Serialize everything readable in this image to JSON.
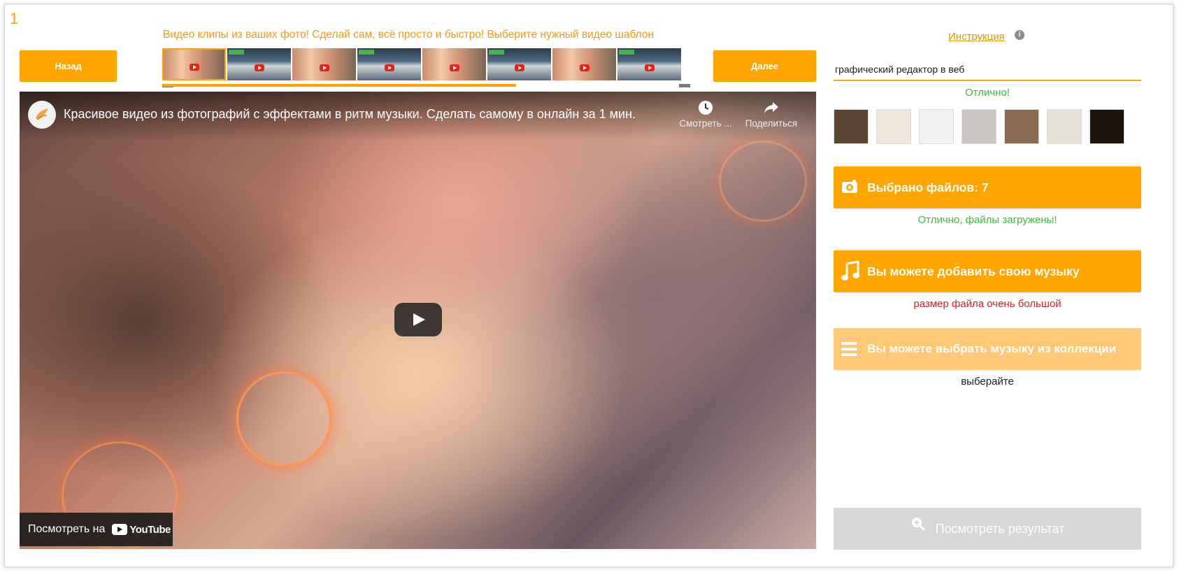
{
  "page": {
    "step_number": "1",
    "tagline": "Видео клипы из ваших фото! Сделай сам, всё просто и быстро! Выберите нужный видео шаблон"
  },
  "nav": {
    "back_label": "Назад",
    "next_label": "Далее"
  },
  "templates": [
    {
      "kind": "portrait",
      "selected": true
    },
    {
      "kind": "scene"
    },
    {
      "kind": "portrait"
    },
    {
      "kind": "scene"
    },
    {
      "kind": "portrait"
    },
    {
      "kind": "scene"
    },
    {
      "kind": "portrait"
    },
    {
      "kind": "scene"
    }
  ],
  "video": {
    "title": "Красивое видео из фотографий с эффектами в ритм музыки. Сделать самому в онлайн за 1 мин.",
    "watch_later_label": "Смотреть ...",
    "share_label": "Поделиться",
    "watch_on_label": "Посмотреть на",
    "youtube_label": "YouTube"
  },
  "sidebar": {
    "instruction_link": "Инструкция ",
    "search_value": "графический редактор в веб",
    "search_status": "Отлично!",
    "files_button": "Выбрано файлов: 7",
    "files_status": "Отлично, файлы загружены!",
    "music_button": "Вы можете добавить свою музыку",
    "music_status": "размер файла очень большой",
    "collection_button": "Вы можете выбрать музыку из коллекции",
    "collection_status": "выберайте",
    "result_button": "Посмотреть результат"
  },
  "search_results": [
    {
      "tone": "#5a4632"
    },
    {
      "tone": "#efe6dc"
    },
    {
      "tone": "#f1f1f1"
    },
    {
      "tone": "#c9c6c1"
    },
    {
      "tone": "#8a6a50"
    },
    {
      "tone": "#e7e2d8"
    },
    {
      "tone": "#1d130d"
    }
  ],
  "colors": {
    "accent": "#ffa500",
    "accent_light": "#ffc878",
    "success": "#3dbb3d",
    "error": "#dd2222",
    "disabled": "#d7d7d7"
  }
}
